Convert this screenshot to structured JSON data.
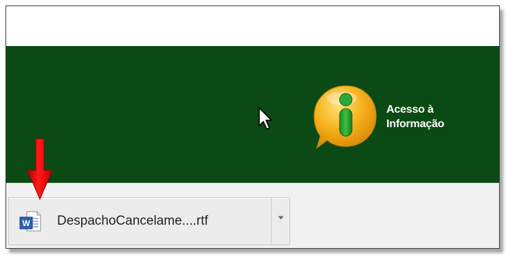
{
  "banner": {
    "background_color": "#0b4a15",
    "logo": {
      "icon": "info-i-icon",
      "text_line1": "Acesso à",
      "text_line2": "Informação"
    }
  },
  "download_bar": {
    "item": {
      "icon": "word-document-icon",
      "filename": "DespachoCancelame....rtf",
      "menu_icon": "chevron-down-icon"
    }
  },
  "annotation": {
    "arrow": "red-arrow-icon",
    "arrow_color": "#e60000"
  }
}
